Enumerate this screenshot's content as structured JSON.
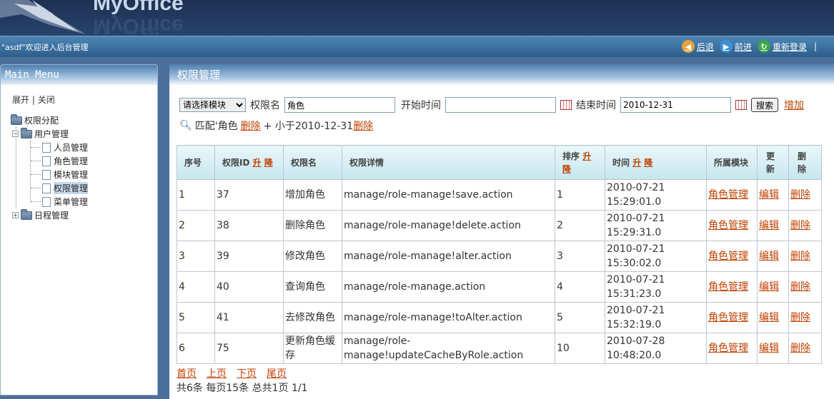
{
  "header": {
    "brand": "MyOffice"
  },
  "navbar": {
    "welcome": "\"asdf\"欢迎进入后台管理",
    "back_label": "后退",
    "forward_label": "前进",
    "relogin_label": "重新登录"
  },
  "sidebar": {
    "title": "Main Menu",
    "expand_label": "展开",
    "collapse_label": "关闭",
    "tree": {
      "root": "权限分配",
      "users": "用户管理",
      "children": [
        "人员管理",
        "角色管理",
        "模块管理",
        "权限管理",
        "菜单管理"
      ],
      "schedule": "日程管理"
    }
  },
  "main": {
    "title": "权限管理",
    "filter": {
      "module_select": "请选择模块",
      "perm_name_label": "权限名",
      "perm_name_value": "角色",
      "start_label": "开始时间",
      "start_value": "",
      "end_label": "结束时间",
      "end_value": "2010-12-31",
      "search_label": "搜索",
      "add_label": "增加"
    },
    "conditions": {
      "match_text": "匹配'角色",
      "delete1": "删除",
      "less_text": "+ 小于2010-12-31",
      "delete2": "删除"
    },
    "table": {
      "headers": {
        "seq": "序号",
        "perm_id": "权限ID",
        "perm_name": "权限名",
        "perm_detail": "权限详情",
        "sort": "排序",
        "time": "时间",
        "module": "所属模块",
        "update": "更新",
        "delete": "删除",
        "asc": "升",
        "desc": "降"
      },
      "rows": [
        {
          "seq": "1",
          "id": "37",
          "name": "增加角色",
          "detail": "manage/role-manage!save.action",
          "sort": "1",
          "date": "2010-07-21",
          "time": "15:29:01.0",
          "module": "角色管理",
          "edit": "编辑",
          "del": "删除"
        },
        {
          "seq": "2",
          "id": "38",
          "name": "删除角色",
          "detail": "manage/role-manage!delete.action",
          "sort": "2",
          "date": "2010-07-21",
          "time": "15:29:31.0",
          "module": "角色管理",
          "edit": "编辑",
          "del": "删除"
        },
        {
          "seq": "3",
          "id": "39",
          "name": "修改角色",
          "detail": "manage/role-manage!alter.action",
          "sort": "3",
          "date": "2010-07-21",
          "time": "15:30:02.0",
          "module": "角色管理",
          "edit": "编辑",
          "del": "删除"
        },
        {
          "seq": "4",
          "id": "40",
          "name": "查询角色",
          "detail": "manage/role-manage.action",
          "sort": "4",
          "date": "2010-07-21",
          "time": "15:31:23.0",
          "module": "角色管理",
          "edit": "编辑",
          "del": "删除"
        },
        {
          "seq": "5",
          "id": "41",
          "name": "去修改角色",
          "detail": "manage/role-manage!toAlter.action",
          "sort": "5",
          "date": "2010-07-21",
          "time": "15:32:19.0",
          "module": "角色管理",
          "edit": "编辑",
          "del": "删除"
        },
        {
          "seq": "6",
          "id": "75",
          "name": "更新角色缓存",
          "detail": "manage/role-manage!updateCacheByRole.action",
          "sort": "10",
          "date": "2010-07-28",
          "time": "10:48:20.0",
          "module": "角色管理",
          "edit": "编辑",
          "del": "删除"
        }
      ]
    },
    "pager": {
      "first": "首页",
      "prev": "上页",
      "next": "下页",
      "last": "尾页",
      "summary": "共6条 每页15条 总共1页 1/1"
    }
  }
}
